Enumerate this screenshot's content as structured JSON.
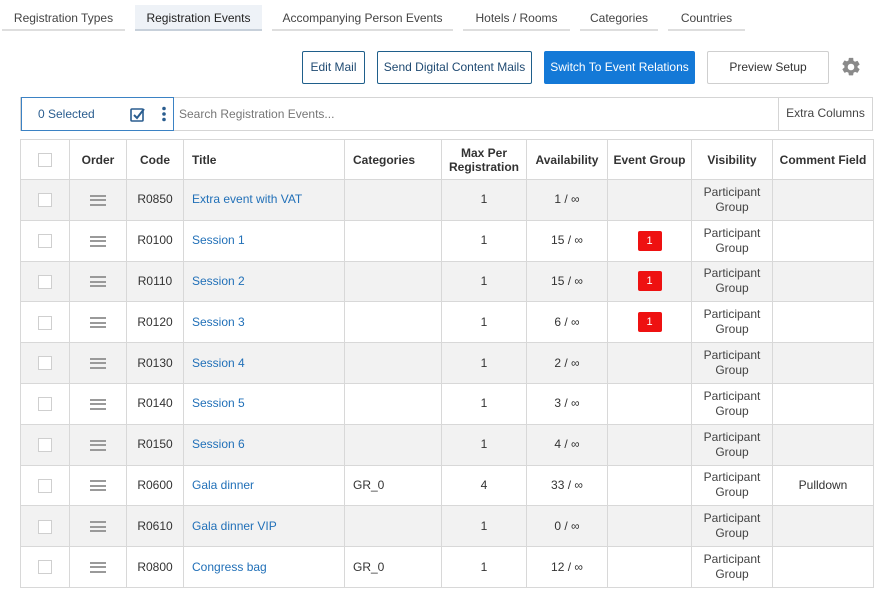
{
  "tabs": [
    {
      "label": "Registration Types",
      "active": false
    },
    {
      "label": "Registration Events",
      "active": true
    },
    {
      "label": "Accompanying Person Events",
      "active": false
    },
    {
      "label": "Hotels / Rooms",
      "active": false
    },
    {
      "label": "Categories",
      "active": false
    },
    {
      "label": "Countries",
      "active": false
    }
  ],
  "toolbar": {
    "edit_mail": "Edit Mail",
    "send_digital": "Send Digital Content Mails",
    "switch_relations": "Switch To Event Relations",
    "preview_setup": "Preview Setup",
    "settings_icon": "gear-icon"
  },
  "selection": {
    "selected_label": "0 Selected",
    "search_placeholder": "Search Registration Events...",
    "search_value": "",
    "extra_columns": "Extra Columns"
  },
  "table": {
    "headers": {
      "order": "Order",
      "code": "Code",
      "title": "Title",
      "categories": "Categories",
      "max_per_registration": "Max Per Registration",
      "availability": "Availability",
      "event_group": "Event Group",
      "visibility": "Visibility",
      "comment_field": "Comment Field"
    },
    "rows": [
      {
        "code": "R0850",
        "title": "Extra event with VAT",
        "categories": "",
        "max": "1",
        "availability": "1 / ∞",
        "event_group": "",
        "visibility": "Participant Group",
        "comment": ""
      },
      {
        "code": "R0100",
        "title": "Session 1",
        "categories": "",
        "max": "1",
        "availability": "15 / ∞",
        "event_group": "1",
        "visibility": "Participant Group",
        "comment": ""
      },
      {
        "code": "R0110",
        "title": "Session 2",
        "categories": "",
        "max": "1",
        "availability": "15 / ∞",
        "event_group": "1",
        "visibility": "Participant Group",
        "comment": ""
      },
      {
        "code": "R0120",
        "title": "Session 3",
        "categories": "",
        "max": "1",
        "availability": "6 / ∞",
        "event_group": "1",
        "visibility": "Participant Group",
        "comment": ""
      },
      {
        "code": "R0130",
        "title": "Session 4",
        "categories": "",
        "max": "1",
        "availability": "2 / ∞",
        "event_group": "",
        "visibility": "Participant Group",
        "comment": ""
      },
      {
        "code": "R0140",
        "title": "Session 5",
        "categories": "",
        "max": "1",
        "availability": "3 / ∞",
        "event_group": "",
        "visibility": "Participant Group",
        "comment": ""
      },
      {
        "code": "R0150",
        "title": "Session 6",
        "categories": "",
        "max": "1",
        "availability": "4 / ∞",
        "event_group": "",
        "visibility": "Participant Group",
        "comment": ""
      },
      {
        "code": "R0600",
        "title": "Gala dinner",
        "categories": "GR_0",
        "max": "4",
        "availability": "33 / ∞",
        "event_group": "",
        "visibility": "Participant Group",
        "comment": "Pulldown"
      },
      {
        "code": "R0610",
        "title": "Gala dinner VIP",
        "categories": "",
        "max": "1",
        "availability": "0 / ∞",
        "event_group": "",
        "visibility": "Participant Group",
        "comment": ""
      },
      {
        "code": "R0800",
        "title": "Congress bag",
        "categories": "GR_0",
        "max": "1",
        "availability": "12 / ∞",
        "event_group": "",
        "visibility": "Participant Group",
        "comment": ""
      }
    ]
  },
  "colors": {
    "primary": "#1479d7",
    "badge": "#ee1111",
    "link": "#2170b8"
  }
}
